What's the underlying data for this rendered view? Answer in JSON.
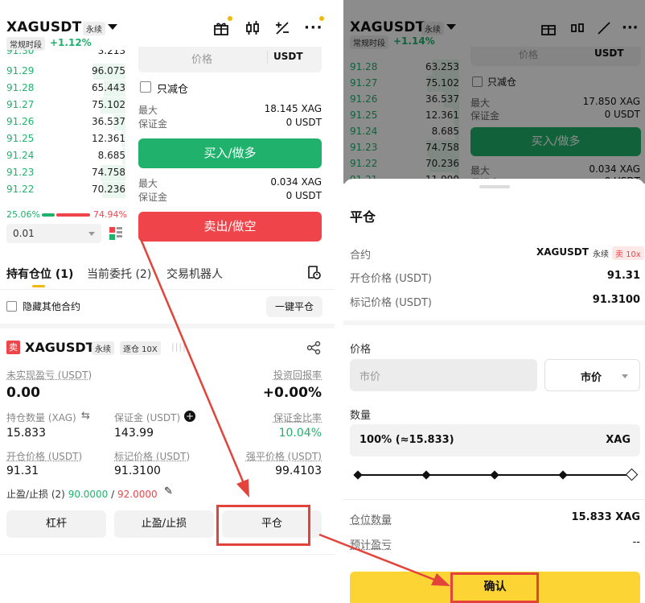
{
  "left": {
    "title": "XAGUSDT",
    "perp_tag": "永续",
    "session": "常规时段",
    "change": "+1.12%",
    "orderbook": [
      {
        "price": "91.29",
        "qty": "96.075"
      },
      {
        "price": "91.28",
        "qty": "65.443"
      },
      {
        "price": "91.27",
        "qty": "75.102"
      },
      {
        "price": "91.26",
        "qty": "36.537"
      },
      {
        "price": "91.25",
        "qty": "12.361"
      },
      {
        "price": "91.24",
        "qty": "8.685"
      },
      {
        "price": "91.23",
        "qty": "74.758"
      },
      {
        "price": "91.22",
        "qty": "70.236"
      }
    ],
    "buy_ratio": "25.06%",
    "sell_ratio": "74.94%",
    "tick": "0.01",
    "price_label": "价格",
    "price_unit": "USDT",
    "reduce_only": "只减仓",
    "max_label": "最大",
    "max_buy": "18.145 XAG",
    "margin_label": "保证金",
    "margin_buy": "0 USDT",
    "buy_button": "买入/做多",
    "max_sell": "0.034 XAG",
    "margin_sell": "0 USDT",
    "sell_button": "卖出/做空",
    "tabs": [
      "持有仓位 (1)",
      "当前委托 (2)",
      "交易机器人"
    ],
    "hide_other": "隐藏其他合约",
    "close_all": "一键平仓",
    "pos_side": "卖",
    "pos_symbol": "XAGUSDT",
    "pos_perp": "永续",
    "pos_mode": "逐仓 10X",
    "unrealized_label": "未实现盈亏 (USDT)",
    "unrealized_val": "0.00",
    "roi_label": "投资回报率",
    "roi_val": "+0.00%",
    "size_label": "持仓数量 (XAG)",
    "size_val": "15.833",
    "pos_margin_label": "保证金 (USDT)",
    "pos_margin_val": "143.99",
    "margin_ratio_label": "保证金比率",
    "margin_ratio_val": "10.04%",
    "entry_label": "开仓价格 (USDT)",
    "entry_val": "91.31",
    "mark_label": "标记价格 (USDT)",
    "mark_val": "91.3100",
    "liq_label": "强平价格 (USDT)",
    "liq_val": "99.4103",
    "tpsl_prefix": "止盈/止损 (2)",
    "tp_val": "90.0000",
    "sl_val": "92.0000",
    "btn_leverage": "杠杆",
    "btn_tpsl": "止盈/止损",
    "btn_close": "平仓"
  },
  "right": {
    "bg_title": "XAGUSDT",
    "bg_perp": "永续",
    "bg_session": "常规时段",
    "bg_change": "+1.14%",
    "bg_orderbook": [
      {
        "price": "91.28",
        "qty": "63.253"
      },
      {
        "price": "91.27",
        "qty": "75.102"
      },
      {
        "price": "91.26",
        "qty": "36.537"
      },
      {
        "price": "91.25",
        "qty": "12.361"
      },
      {
        "price": "91.24",
        "qty": "8.685"
      },
      {
        "price": "91.23",
        "qty": "74.758"
      },
      {
        "price": "91.22",
        "qty": "70.236"
      },
      {
        "price": "91.21",
        "qty": "11.990"
      }
    ],
    "bg_price_label": "价格",
    "bg_price_unit": "USDT",
    "bg_reduce_only": "只减仓",
    "bg_max_label": "最大",
    "bg_max_buy": "17.850 XAG",
    "bg_margin_label": "保证金",
    "bg_margin_buy": "0 USDT",
    "bg_buy_button": "买入/做多",
    "bg_max_sell": "0.034 XAG",
    "bg_margin_sell": "0 USDT",
    "sheet_title": "平仓",
    "contract_label": "合约",
    "contract_symbol": "XAGUSDT",
    "contract_perp": "永续",
    "contract_side": "卖 10x",
    "entry_label": "开仓价格 (USDT)",
    "entry_val": "91.31",
    "mark_label": "标记价格 (USDT)",
    "mark_val": "91.3100",
    "price_section": "价格",
    "price_placeholder": "市价",
    "order_type": "市价",
    "qty_section": "数量",
    "qty_value": "100% (≈15.833)",
    "qty_unit": "XAG",
    "pos_qty_label": "仓位数量",
    "pos_qty_val": "15.833 XAG",
    "est_pnl_label": "预计盈亏",
    "est_pnl_val": "--",
    "confirm_button": "确认"
  },
  "colors": {
    "green": "#20b26c",
    "red": "#ef454a",
    "yellow": "#fcd535",
    "highlight": "#e2443b"
  }
}
